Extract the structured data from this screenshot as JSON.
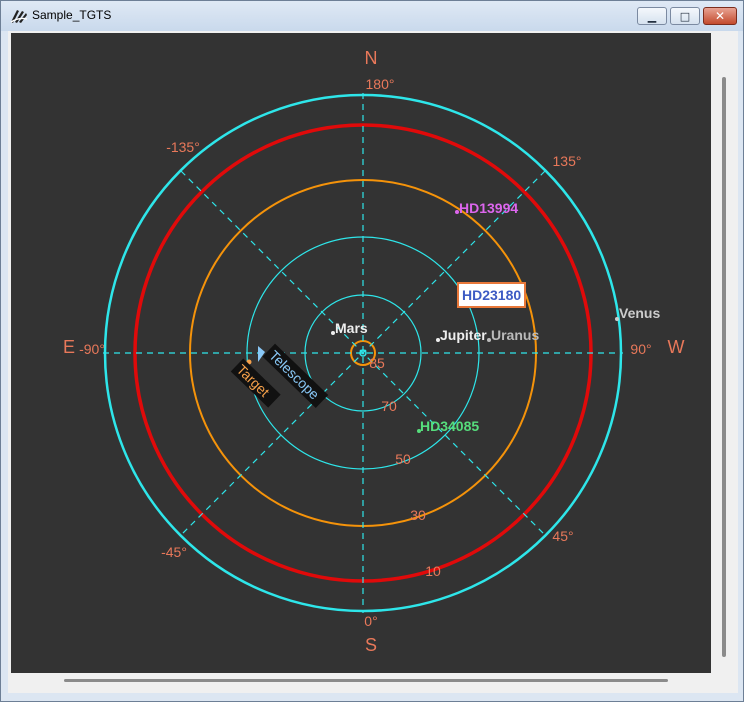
{
  "window": {
    "title": "Sample_TGTS",
    "minimize_glyph": "▁",
    "maximize_glyph": "□",
    "close_glyph": "✕"
  },
  "colors": {
    "background": "#333333",
    "tan": "#e8785a",
    "cyan": "#2ee6ea",
    "red": "#e00a0a",
    "orange": "#f5930a",
    "magenta": "#dd66ee",
    "blue": "#3d5bc4",
    "green": "#56dd7c",
    "white": "#eeeeee",
    "telescope": "#89c8f7",
    "target": "#f5a04a"
  },
  "cardinals": {
    "north": "N",
    "south": "S",
    "east": "E",
    "west": "W"
  },
  "azimuth_labels": {
    "top": "180°",
    "top_left": "-135°",
    "top_right": "135°",
    "left": "-90°",
    "right": "90°",
    "bottom_left": "-45°",
    "bottom_right": "45°",
    "bottom": "0°"
  },
  "altitude_labels": [
    "85",
    "70",
    "50",
    "30",
    "10"
  ],
  "objects": {
    "hd13994": "HD13994",
    "hd23180": "HD23180",
    "venus": "Venus",
    "mars": "Mars",
    "jupiter": "Jupiter",
    "uranus": "Uranus",
    "hd34085": "HD34085"
  },
  "telescope_label": "Telescope",
  "target_label": "Target"
}
